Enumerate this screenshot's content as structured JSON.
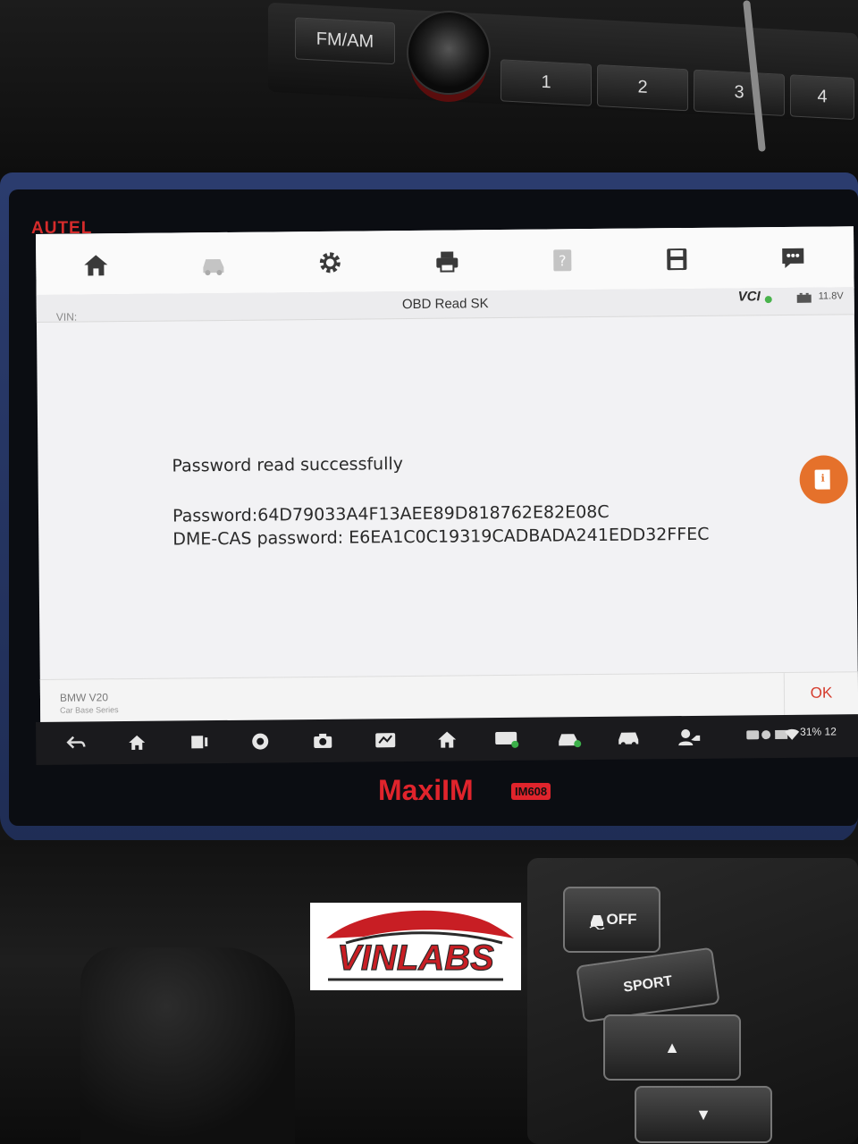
{
  "car_radio": {
    "band_label": "FM/AM",
    "presets": [
      "1",
      "2",
      "3",
      "4"
    ]
  },
  "device": {
    "brand": "AUTEL",
    "model": "MaxiIM",
    "model_badge": "IM608"
  },
  "toolbar": {
    "items": [
      "home-icon",
      "vehicle-icon",
      "settings-icon",
      "print-icon",
      "help-icon",
      "save-icon",
      "feedback-icon"
    ]
  },
  "header": {
    "vin_label": "VIN:",
    "title": "OBD Read SK",
    "vci_label": "VCI",
    "voltage": "11.8V"
  },
  "result": {
    "status": "Password read successfully",
    "password_line": "Password:64D79033A4F13AEE89D818762E82E08C",
    "dme_cas_line": "DME-CAS password: E6EA1C0C19319CADBADA241EDD32FFEC"
  },
  "footer": {
    "vehicle_name": "BMW V20",
    "vehicle_series": "Car Base Series",
    "ok_label": "OK"
  },
  "android_status": {
    "battery_text": "31%",
    "clock_partial": "12"
  },
  "console": {
    "off_label": "OFF",
    "sport_label": "SPORT"
  },
  "watermark": {
    "text": "VINLABS"
  },
  "colors": {
    "accent_red": "#d53a2b",
    "info_orange": "#e5712b",
    "device_blue": "#2b3c6e"
  }
}
